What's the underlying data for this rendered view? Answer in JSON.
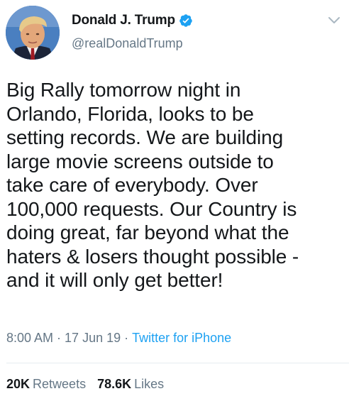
{
  "author": {
    "name": "Donald J. Trump",
    "handle": "@realDonaldTrump",
    "verified": true
  },
  "tweet": {
    "text": "Big Rally tomorrow night in\nOrlando, Florida, looks to be\nsetting records. We are building\nlarge movie screens outside to\ntake care of everybody. Over\n100,000 requests. Our Country is\ndoing great, far beyond what the\nhaters & losers thought possible -\nand it will only get better!"
  },
  "meta": {
    "time": "8:00 AM",
    "separator": "·",
    "date": "17 Jun 19",
    "source": "Twitter for iPhone"
  },
  "stats": {
    "retweets_count": "20K",
    "retweets_label": "Retweets",
    "likes_count": "78.6K",
    "likes_label": "Likes"
  },
  "icons": {
    "verified": "verified-badge-icon",
    "menu": "chevron-down-icon"
  },
  "colors": {
    "verified": "#1da1f2",
    "link": "#1da1f2",
    "secondary_text": "#657786",
    "primary_text": "#14171a",
    "divider": "#e6ecf0"
  }
}
